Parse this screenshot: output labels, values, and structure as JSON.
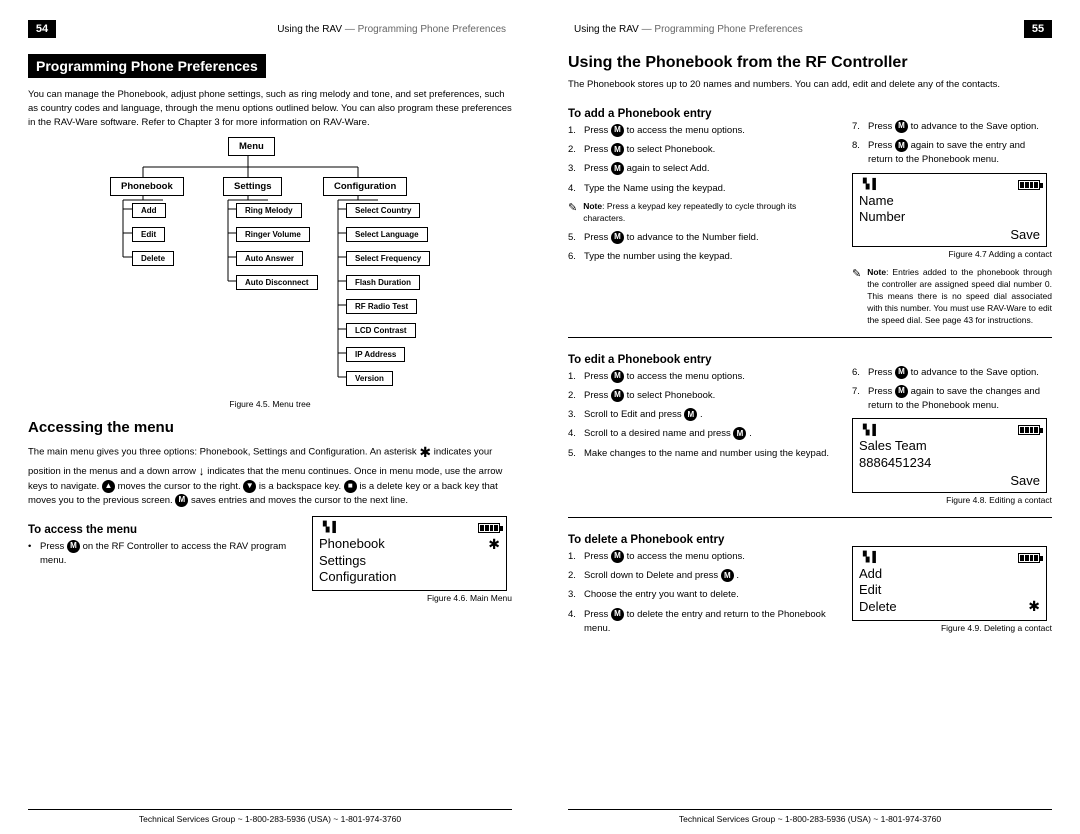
{
  "leftPage": {
    "pageNum": "54",
    "headerA": "Using the RAV",
    "headerB": "— Programming Phone Preferences",
    "bandTitle": "Programming Phone Preferences",
    "intro": "You can manage the Phonebook, adjust phone settings, such as ring melody and tone, and set preferences, such as country codes and language, through the menu options outlined below. You can also program these preferences in the RAV-Ware software. Refer to Chapter 3 for more information on RAV-Ware.",
    "menuTree": {
      "root": "Menu",
      "phonebook": "Phonebook",
      "settings": "Settings",
      "configuration": "Configuration",
      "phonebookItems": [
        "Add",
        "Edit",
        "Delete"
      ],
      "settingsItems": [
        "Ring Melody",
        "Ringer Volume",
        "Auto Answer",
        "Auto Disconnect"
      ],
      "configItems": [
        "Select Country",
        "Select Language",
        "Select Frequency",
        "Flash Duration",
        "RF Radio Test",
        "LCD Contrast",
        "IP Address",
        "Version"
      ],
      "caption": "Figure 4.5. Menu tree"
    },
    "accessingTitle": "Accessing the menu",
    "accessingBody1a": "The main menu gives you three options: Phonebook, Settings and Configuration. An asterisk ",
    "accessingBody1b": " indicates your position in the menus and a down arrow ",
    "accessingBody1c": " indicates that the menu continues. Once in menu mode, use the arrow keys to navigate. ",
    "accessingBody1d": " moves the cursor to the right. ",
    "accessingBody1e": " is a backspace key. ",
    "accessingBody1f": " is a delete key or a back key that moves you to the previous screen. ",
    "accessingBody1g": " saves entries and moves the cursor to the next line.",
    "toAccessTitle": "To access the menu",
    "toAccessBullet_a": "Press ",
    "toAccessBullet_b": " on the RF Controller to access the RAV program menu.",
    "lcdMain": {
      "l1": "Phonebook",
      "l2": "Settings",
      "l3": "Configuration",
      "caption": "Figure 4.6. Main Menu"
    }
  },
  "rightPage": {
    "pageNum": "55",
    "headerA": "Using the RAV",
    "headerB": "— Programming Phone Preferences",
    "title": "Using the Phonebook from the RF Controller",
    "intro": "The Phonebook stores up to 20 names and numbers. You can add, edit and delete any of the contacts.",
    "addTitle": "To add a Phonebook entry",
    "addStepsL": {
      "s1a": "Press ",
      "s1b": " to access the menu options.",
      "s2a": "Press ",
      "s2b": " to select Phonebook.",
      "s3a": "Press ",
      "s3b": " again to select Add.",
      "s4": "Type the Name using the keypad.",
      "noteLabel": "Note",
      "note": "Press a keypad key repeatedly to cycle through its characters.",
      "s5a": "Press ",
      "s5b": " to advance to the Number field.",
      "s6": "Type the number using the keypad."
    },
    "addStepsR": {
      "s7a": "Press ",
      "s7b": " to advance to the Save option.",
      "s8a": "Press ",
      "s8b": " again to save the entry and return to the Phonebook menu."
    },
    "lcdAdd": {
      "l1": "Name",
      "l2": "Number",
      "save": "Save",
      "caption": "Figure 4.7 Adding a contact"
    },
    "addNote2Label": "Note",
    "addNote2": "Entries added to the phonebook through the controller are assigned speed dial number 0. This means there is no speed dial associated with this number. You must use RAV-Ware to edit the speed dial. See page 43 for instructions.",
    "editTitle": "To edit a Phonebook entry",
    "editL": {
      "s1a": "Press ",
      "s1b": " to access the menu options.",
      "s2a": "Press ",
      "s2b": " to select Phonebook.",
      "s3a": "Scroll to Edit and press ",
      "s3b": " .",
      "s4a": "Scroll to a desired name and press ",
      "s4b": " .",
      "s5": "Make changes to the name and number using the keypad."
    },
    "editR": {
      "s6a": "Press ",
      "s6b": " to advance to the Save option.",
      "s7a": "Press ",
      "s7b": " again to save the changes and return to the Phonebook menu."
    },
    "lcdEdit": {
      "l1": "Sales Team",
      "l2": "8886451234",
      "save": "Save",
      "caption": "Figure 4.8. Editing a contact"
    },
    "delTitle": "To delete a Phonebook entry",
    "delL": {
      "s1a": "Press ",
      "s1b": " to access the menu options.",
      "s2a": "Scroll down to Delete and press ",
      "s2b": " .",
      "s3": "Choose the entry you want to delete.",
      "s4a": "Press ",
      "s4b": " to delete the entry and return to the Phonebook menu."
    },
    "lcdDel": {
      "l1": "Add",
      "l2": "Edit",
      "l3": "Delete",
      "caption": "Figure 4.9. Deleting a contact"
    }
  },
  "footer": "Technical Services Group ~ 1-800-283-5936 (USA) ~ 1-801-974-3760",
  "keys": {
    "M": "M",
    "up": "▲",
    "down": "▼",
    "redial": "■"
  }
}
